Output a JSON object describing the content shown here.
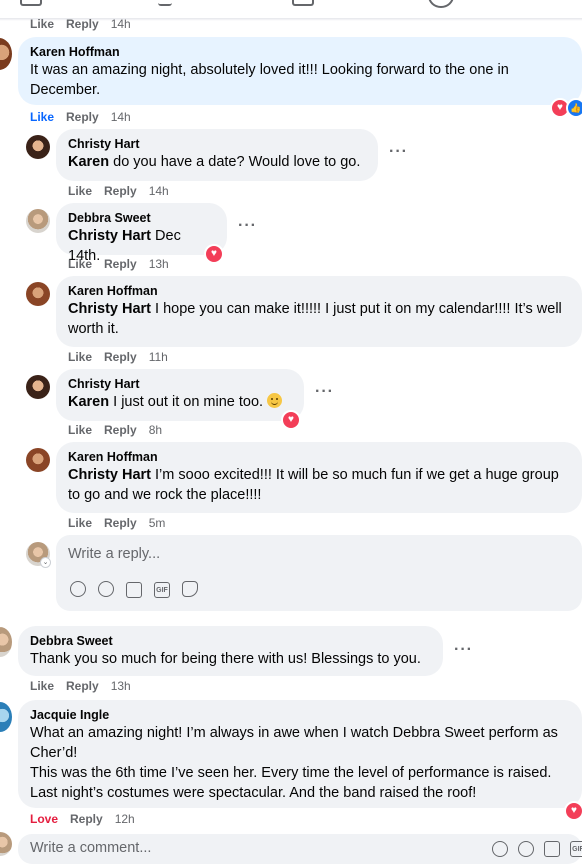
{
  "top_actions": {
    "like": "Like",
    "reply": "Reply",
    "time": "14h"
  },
  "comments": [
    {
      "name": "Karen Hoffman",
      "text": "It was an amazing night, absolutely loved it!!! Looking forward to the one in December.",
      "like": "Like",
      "reply": "Reply",
      "time": "14h"
    },
    {
      "name": "Debbra Sweet",
      "text": "Thank you so much for being there with us! Blessings to you.",
      "like": "Like",
      "reply": "Reply",
      "time": "13h"
    },
    {
      "name": "Jacquie Ingle",
      "lines": [
        "What an amazing night! I’m always in awe when I watch Debbra Sweet perform as Cher’d!",
        "This was the 6th time I’ve seen her. Every time the level of performance is raised.",
        "Last night’s costumes were spectacular. And the band raised the roof!"
      ],
      "like": "Love",
      "reply": "Reply",
      "time": "12h"
    }
  ],
  "replies": [
    {
      "name": "Christy Hart",
      "tag": "Karen",
      "text": " do you have a date? Would love to go.",
      "like": "Like",
      "reply": "Reply",
      "time": "14h"
    },
    {
      "name": "Debbra Sweet",
      "tag": "Christy Hart",
      "text": " Dec 14th.",
      "like": "Like",
      "reply": "Reply",
      "time": "13h"
    },
    {
      "name": "Karen Hoffman",
      "tag": "Christy Hart",
      "text": " I hope you can make it!!!!! I just put it on my calendar!!!! It’s well worth it.",
      "like": "Like",
      "reply": "Reply",
      "time": "11h"
    },
    {
      "name": "Christy Hart",
      "tag": "Karen",
      "text": " I just out it on mine too. ",
      "like": "Like",
      "reply": "Reply",
      "time": "8h"
    },
    {
      "name": "Karen Hoffman",
      "tag": "Christy Hart",
      "text": " I’m sooo excited!!! It will be so much fun if we get a huge group to go and we rock the place!!!!",
      "like": "Like",
      "reply": "Reply",
      "time": "5m"
    }
  ],
  "reply_box": {
    "placeholder": "Write a reply..."
  },
  "comment_box": {
    "placeholder": "Write a comment..."
  },
  "icons": [
    "heart-reaction-icon",
    "like-reaction-icon",
    "more-options-icon",
    "smile-emoji-icon",
    "sticker-icon",
    "emoji-icon",
    "camera-icon",
    "gif-icon",
    "avatar-sticker-icon"
  ],
  "colors": {
    "bubble": "#f0f2f5",
    "highlight_bubble": "#e7f3ff",
    "link_blue": "#0866ff",
    "love_red": "#e41e3f",
    "heart": "#f33e58",
    "meta_gray": "#65676b"
  }
}
